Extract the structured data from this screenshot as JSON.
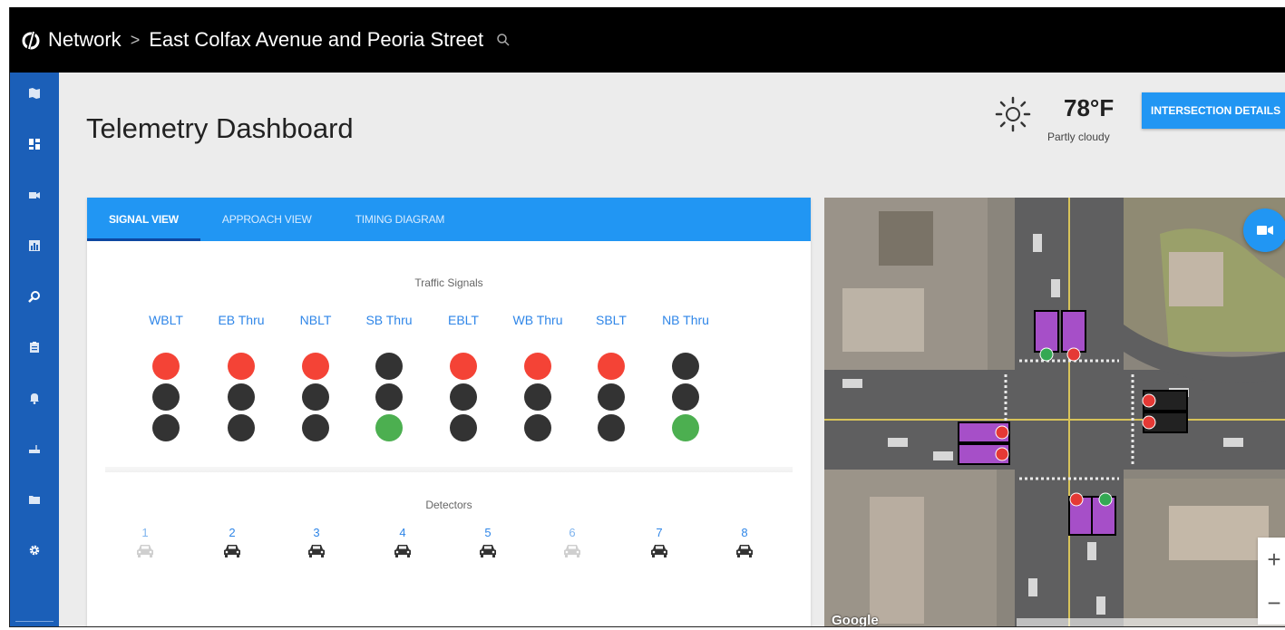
{
  "topbar": {
    "crumbs": [
      "Network",
      "East Colfax Avenue and Peoria Street"
    ],
    "separator": ">"
  },
  "sidebar": {
    "items": [
      {
        "icon": "map-icon"
      },
      {
        "icon": "dashboard-icon"
      },
      {
        "icon": "camera-icon"
      },
      {
        "icon": "bar-chart-icon"
      },
      {
        "icon": "search-icon"
      },
      {
        "icon": "clipboard-icon"
      },
      {
        "icon": "bell-icon"
      },
      {
        "icon": "router-icon"
      },
      {
        "icon": "folder-icon"
      },
      {
        "icon": "gear-icon"
      }
    ]
  },
  "header": {
    "title": "Telemetry Dashboard",
    "weather": {
      "temp": "78°F",
      "condition": "Partly cloudy",
      "icon": "sun-icon"
    },
    "details_button": "INTERSECTION DETAILS"
  },
  "tabs": [
    {
      "label": "SIGNAL VIEW",
      "active": true
    },
    {
      "label": "APPROACH VIEW",
      "active": false
    },
    {
      "label": "TIMING DIAGRAM",
      "active": false
    }
  ],
  "signals": {
    "title": "Traffic Signals",
    "items": [
      {
        "label": "WBLT",
        "state": "red"
      },
      {
        "label": "EB Thru",
        "state": "red"
      },
      {
        "label": "NBLT",
        "state": "red"
      },
      {
        "label": "SB Thru",
        "state": "green"
      },
      {
        "label": "EBLT",
        "state": "red"
      },
      {
        "label": "WB Thru",
        "state": "red"
      },
      {
        "label": "SBLT",
        "state": "red"
      },
      {
        "label": "NB Thru",
        "state": "green"
      }
    ]
  },
  "detectors": {
    "title": "Detectors",
    "items": [
      {
        "num": "1",
        "active": false
      },
      {
        "num": "2",
        "active": true
      },
      {
        "num": "3",
        "active": true
      },
      {
        "num": "4",
        "active": true
      },
      {
        "num": "5",
        "active": true
      },
      {
        "num": "6",
        "active": false
      },
      {
        "num": "7",
        "active": true
      },
      {
        "num": "8",
        "active": true
      }
    ]
  },
  "map": {
    "attribution": "Google",
    "zoom_in": "+",
    "zoom_out": "−"
  },
  "colors": {
    "accent": "#2196f3",
    "sidebar": "#1b5fb8",
    "signal_red": "#f44336",
    "signal_green": "#4caf50",
    "signal_off": "#333333"
  }
}
